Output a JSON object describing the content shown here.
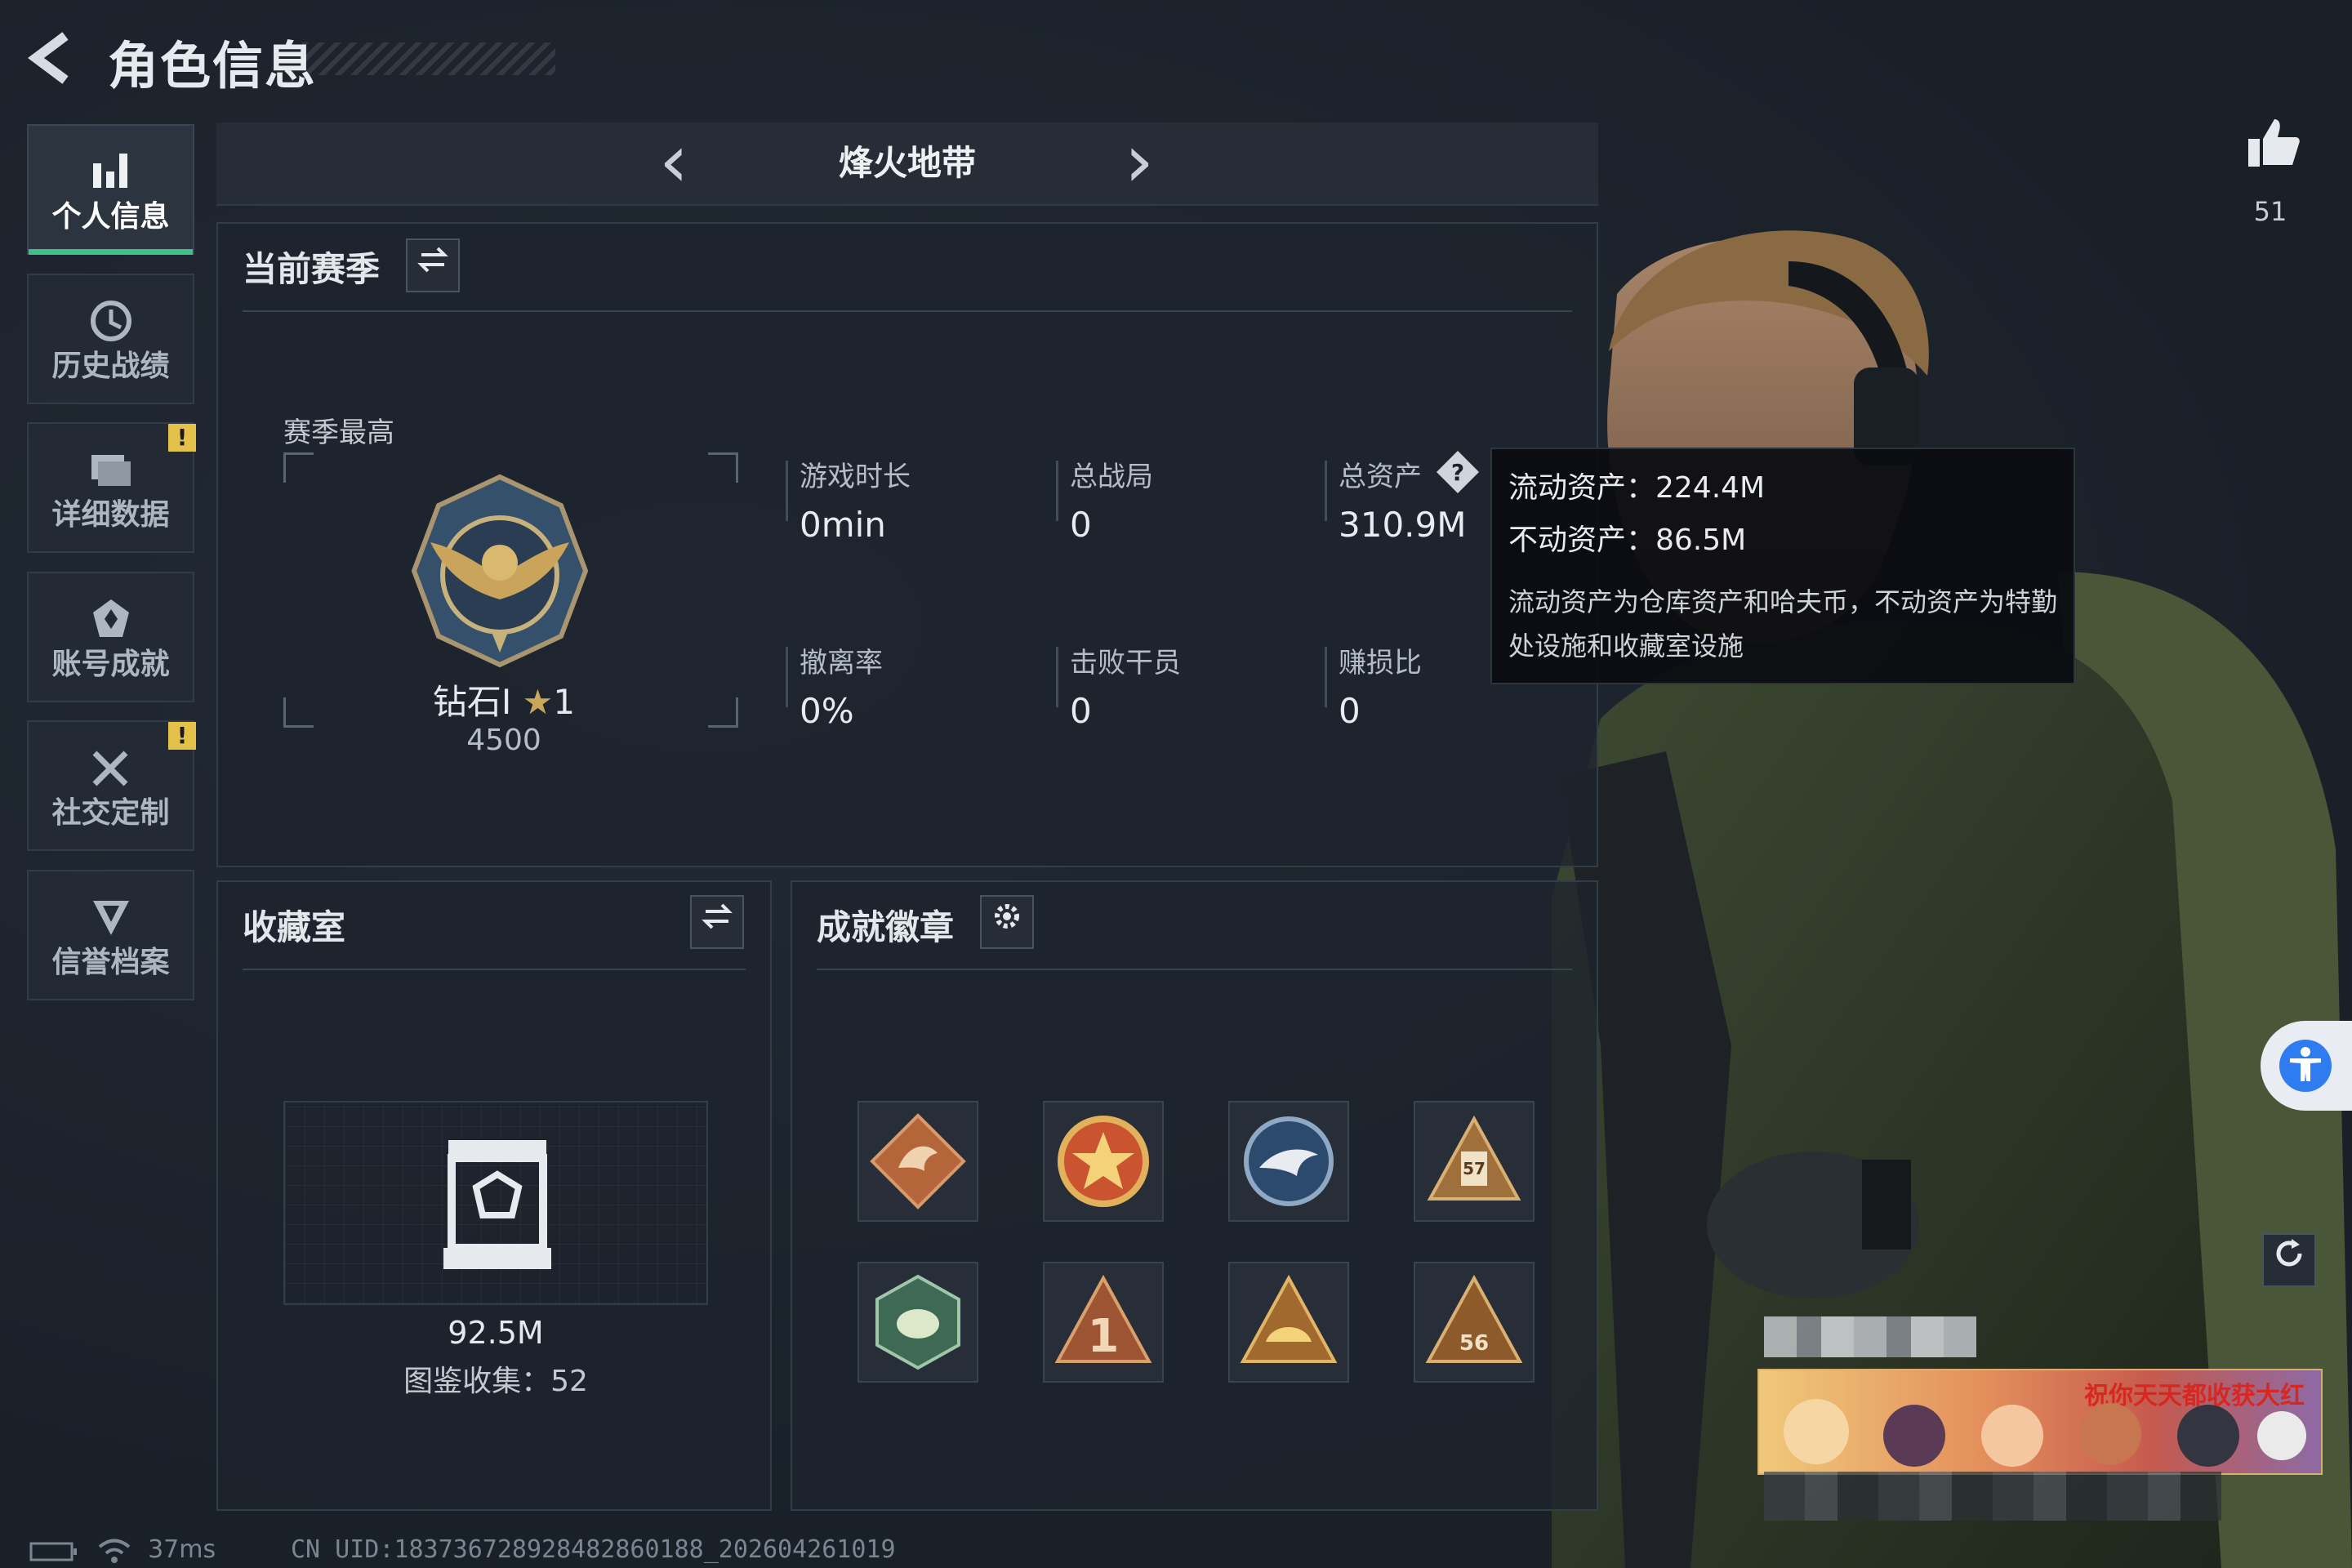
{
  "header": {
    "title": "角色信息"
  },
  "sidebar": {
    "items": [
      {
        "label": "个人信息",
        "icon": "bar-chart-icon",
        "active": true,
        "warning": false
      },
      {
        "label": "历史战绩",
        "icon": "history-icon",
        "active": false,
        "warning": false
      },
      {
        "label": "详细数据",
        "icon": "folder-icon",
        "active": false,
        "warning": true
      },
      {
        "label": "账号成就",
        "icon": "achievement-icon",
        "active": false,
        "warning": false
      },
      {
        "label": "社交定制",
        "icon": "tools-icon",
        "active": false,
        "warning": true
      },
      {
        "label": "信誉档案",
        "icon": "shield-icon",
        "active": false,
        "warning": false
      }
    ],
    "warning_mark": "!"
  },
  "mode": {
    "title": "烽火地带",
    "prev": "‹",
    "next": "›"
  },
  "season": {
    "title": "当前赛季",
    "highest_label": "赛季最高",
    "rank_name": "钻石I",
    "rank_stars": "1",
    "rank_score": "4500",
    "stats": [
      {
        "label": "游戏时长",
        "value": "0min"
      },
      {
        "label": "总战局",
        "value": "0"
      },
      {
        "label": "总资产",
        "value": "310.9M"
      },
      {
        "label": "撤离率",
        "value": "0%"
      },
      {
        "label": "击败干员",
        "value": "0"
      },
      {
        "label": "赚损比",
        "value": "0"
      }
    ]
  },
  "tooltip": {
    "liquid": "流动资产：224.4M",
    "fixed": "不动资产：86.5M",
    "desc": "流动资产为仓库资产和哈夫币，不动资产为特勤处设施和收藏室设施"
  },
  "collection": {
    "title": "收藏室",
    "value": "92.5M",
    "collected": "图鉴收集：52"
  },
  "badges": {
    "title": "成就徽章",
    "items": [
      {
        "icon": "dragon-badge-icon",
        "color": "#b5653a"
      },
      {
        "icon": "star-medal-badge-icon",
        "color": "#c9542f"
      },
      {
        "icon": "eagle-badge-icon",
        "color": "#3b5d86"
      },
      {
        "icon": "cargo-badge-icon",
        "color": "#b8884a"
      },
      {
        "icon": "hornet-badge-icon",
        "color": "#4f7d62"
      },
      {
        "icon": "number-one-badge-icon",
        "color": "#b5653a"
      },
      {
        "icon": "hat-badge-icon",
        "color": "#c8913f"
      },
      {
        "icon": "numbered-badge-icon",
        "color": "#b8884a"
      }
    ],
    "numbers": {
      "cargo": "57",
      "numbered": "56",
      "one": "1"
    }
  },
  "likes": {
    "count": "51"
  },
  "banner": {
    "text": "祝你天天都收获大红"
  },
  "status": {
    "ping": "37ms",
    "uid": "CN UID:183736728928482860188_202604261019"
  },
  "colors": {
    "accent": "#3fbf8a",
    "warning": "#e4c24a",
    "a11y": "#2f7bf0"
  }
}
